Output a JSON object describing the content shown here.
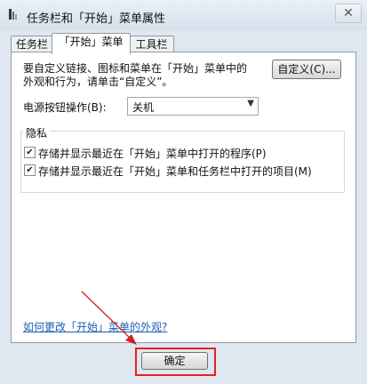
{
  "window": {
    "title": "任务栏和「开始」菜单属性",
    "close_glyph": "✕"
  },
  "tabs": [
    {
      "label": "任务栏"
    },
    {
      "label": "「开始」菜单",
      "active": true
    },
    {
      "label": "工具栏"
    }
  ],
  "start_menu": {
    "customize_text_line1": "要自定义链接、图标和菜单在「开始」菜单中的",
    "customize_text_line2": "外观和行为，请单击“自定义”。",
    "customize_button": "自定义(C)...",
    "power_label": "电源按钮操作(B):",
    "power_value": "关机",
    "privacy": {
      "legend": "隐私",
      "items": [
        {
          "label": "存储并显示最近在「开始」菜单中打开的程序(P)",
          "checked": true
        },
        {
          "label": "存储并显示最近在「开始」菜单和任务栏中打开的项目(M)",
          "checked": true
        }
      ]
    },
    "help_link": "如何更改「开始」菜单的外观?"
  },
  "buttons": {
    "ok": "确定"
  },
  "annotation": {
    "arrow_color": "#d42020",
    "highlight_color": "#e32222"
  }
}
